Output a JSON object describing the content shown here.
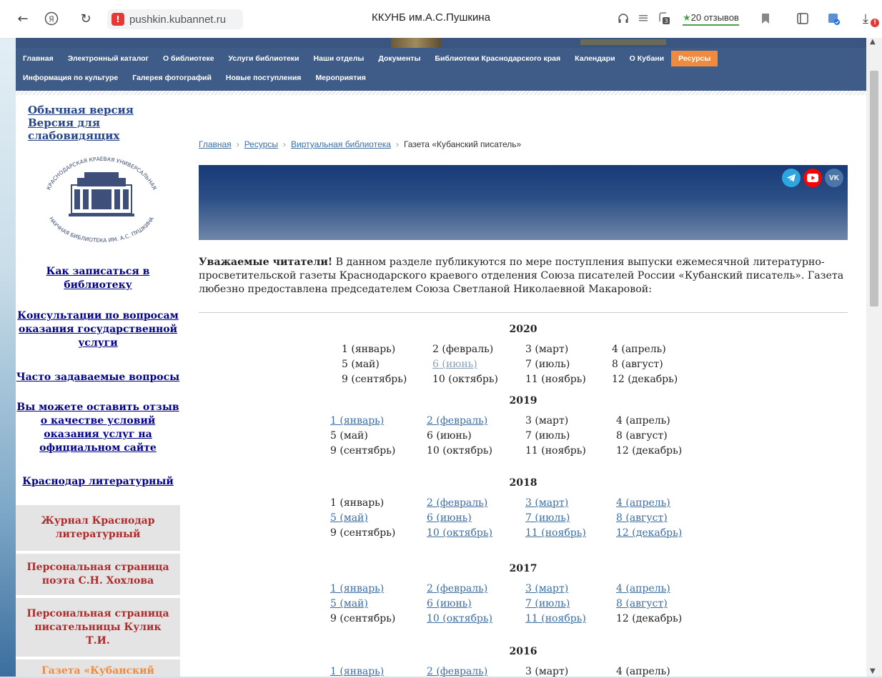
{
  "browser": {
    "url": "pushkin.kubannet.ru",
    "title": "ККУНБ им.А.С.Пушкина",
    "reviews_label": "20 отзывов",
    "tab_count": "3",
    "download_badge": "!"
  },
  "nav": {
    "row1": [
      "Главная",
      "Электронный каталог",
      "О библиотеке",
      "Услуги библиотеки",
      "Наши отделы",
      "Документы",
      "Библиотеки Краснодарского края",
      "Календари",
      "О Кубани",
      "Ресурсы"
    ],
    "row2": [
      "Информация по культуре",
      "Галерея фотографий",
      "Новые поступления",
      "Мероприятия"
    ],
    "active": "Ресурсы"
  },
  "sidebar": {
    "normal_version": "Обычная версия",
    "low_vision_version": "Версия для слабовидящих",
    "logo_top": "КРАСНОДАРСКАЯ КРАЕВАЯ УНИВЕРСАЛЬНАЯ",
    "logo_bottom": "НАУЧНАЯ БИБЛИОТЕКА ИМ. А.С. ПУШКИНА",
    "link_signup": "Как записаться в библиотеку",
    "link_consult": "Консультации по вопросам оказания государственной услуги",
    "link_faq": "Часто задаваемые вопросы",
    "link_feedback": "Вы можете оставить отзыв о качестве условий оказания услуг на официальном сайте",
    "link_krasnodar": "Краснодар литературный",
    "box1": "Журнал Краснодар литературный",
    "box2": "Персональная страница поэта С.Н. Хохлова",
    "box3": "Персональная страница писательницы Кулик Т.И.",
    "box4": "Газета «Кубанский"
  },
  "breadcrumb": {
    "items": [
      "Главная",
      "Ресурсы",
      "Виртуальная библиотека"
    ],
    "current": "Газета «Кубанский писатель»"
  },
  "intro": {
    "bold": "Уважаемые читатели!",
    "text": " В данном разделе публикуются по мере поступления выпуски ежемесячной литературно-просветительской газеты Краснодарского краевого отделения Союза писателей России «Кубанский писатель». Газета любезно предоставлена председателем Союза Светланой Николаевной Макаровой:"
  },
  "archive": [
    {
      "year": "2020",
      "months": [
        {
          "label": "1 (январь)",
          "state": "text"
        },
        {
          "label": "2 (февраль)",
          "state": "text"
        },
        {
          "label": "3 (март)",
          "state": "text"
        },
        {
          "label": "4 (апрель)",
          "state": "text"
        },
        {
          "label": "5 (май)",
          "state": "text"
        },
        {
          "label": "6 (июнь)",
          "state": "visited"
        },
        {
          "label": "7 (июль)",
          "state": "text"
        },
        {
          "label": "8 (август)",
          "state": "text"
        },
        {
          "label": "9 (сентябрь)",
          "state": "text"
        },
        {
          "label": "10 (октябрь)",
          "state": "text"
        },
        {
          "label": "11 (ноябрь)",
          "state": "text"
        },
        {
          "label": "12 (декабрь)",
          "state": "text"
        }
      ]
    },
    {
      "year": "2019",
      "months": [
        {
          "label": "1 (январь)",
          "state": "link"
        },
        {
          "label": "2 (февраль)",
          "state": "link"
        },
        {
          "label": "3 (март)",
          "state": "text"
        },
        {
          "label": "4 (апрель)",
          "state": "text"
        },
        {
          "label": "5 (май)",
          "state": "text"
        },
        {
          "label": "6 (июнь)",
          "state": "text"
        },
        {
          "label": "7 (июль)",
          "state": "text"
        },
        {
          "label": "8 (август)",
          "state": "text"
        },
        {
          "label": "9 (сентябрь)",
          "state": "text"
        },
        {
          "label": "10 (октябрь)",
          "state": "text"
        },
        {
          "label": "11 (ноябрь)",
          "state": "text"
        },
        {
          "label": "12 (декабрь)",
          "state": "text"
        }
      ]
    },
    {
      "year": "2018",
      "months": [
        {
          "label": "1 (январь)",
          "state": "text"
        },
        {
          "label": "2 (февраль)",
          "state": "link"
        },
        {
          "label": "3 (март)",
          "state": "link"
        },
        {
          "label": "4 (апрель)",
          "state": "link"
        },
        {
          "label": "5 (май)",
          "state": "link"
        },
        {
          "label": "6 (июнь)",
          "state": "link"
        },
        {
          "label": "7 (июль)",
          "state": "link"
        },
        {
          "label": "8 (август)",
          "state": "link"
        },
        {
          "label": "9 (сентябрь)",
          "state": "text"
        },
        {
          "label": "10 (октябрь)",
          "state": "link"
        },
        {
          "label": "11 (ноябрь)",
          "state": "link"
        },
        {
          "label": "12 (декабрь)",
          "state": "link"
        }
      ]
    },
    {
      "year": "2017",
      "months": [
        {
          "label": "1 (январь)",
          "state": "link"
        },
        {
          "label": "2 (февраль)",
          "state": "link"
        },
        {
          "label": "3 (март)",
          "state": "link"
        },
        {
          "label": "4 (апрель)",
          "state": "link"
        },
        {
          "label": "5 (май)",
          "state": "link"
        },
        {
          "label": "6 (июнь)",
          "state": "link"
        },
        {
          "label": "7 (июль)",
          "state": "link"
        },
        {
          "label": "8 (август)",
          "state": "link"
        },
        {
          "label": "9 (сентябрь)",
          "state": "text"
        },
        {
          "label": "10 (октябрь)",
          "state": "link"
        },
        {
          "label": "11 (ноябрь)",
          "state": "link"
        },
        {
          "label": "12 (декабрь)",
          "state": "text"
        }
      ]
    },
    {
      "year": "2016",
      "months": [
        {
          "label": "1 (январь)",
          "state": "link"
        },
        {
          "label": "2 (февраль)",
          "state": "link"
        },
        {
          "label": "3 (март)",
          "state": "text"
        },
        {
          "label": "4 (апрель)",
          "state": "text"
        }
      ]
    }
  ],
  "colors": {
    "nav_bg": "#3e5c87",
    "nav_active": "#f08a3c",
    "link": "#3b6ea5",
    "sidebar_link": "#00008b",
    "box_text": "#b02a2a"
  }
}
